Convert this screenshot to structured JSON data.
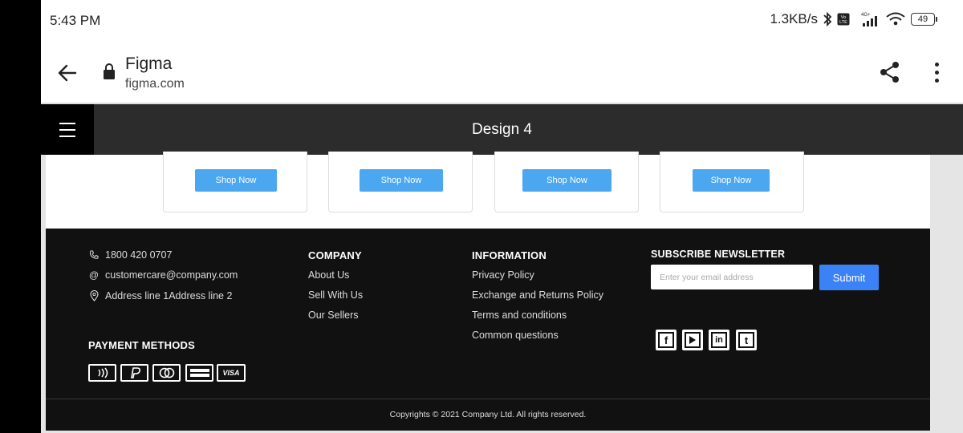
{
  "status_bar": {
    "time": "5:43 PM",
    "net_speed": "1.3KB/s",
    "network_type": "4G+",
    "battery": "49"
  },
  "browser": {
    "site_title": "Figma",
    "site_url": "figma.com"
  },
  "figma": {
    "title": "Design 4"
  },
  "cards": [
    {
      "button_label": "Shop Now"
    },
    {
      "button_label": "Shop Now"
    },
    {
      "button_label": "Shop Now"
    },
    {
      "button_label": "Shop Now"
    }
  ],
  "footer": {
    "contact": {
      "phone": "1800 420 0707",
      "email": "customercare@company.com",
      "address": "Address line 1Address line 2"
    },
    "payment_heading": "PAYMENT METHODS",
    "payment_methods": [
      "contactless-pay",
      "paypal",
      "diners-club",
      "american-express",
      "VISA"
    ],
    "company": {
      "heading": "COMPANY",
      "links": [
        "About Us",
        "Sell With Us",
        "Our Sellers"
      ]
    },
    "information": {
      "heading": "INFORMATION",
      "links": [
        "Privacy Policy",
        "Exchange and Returns Policy",
        "Terms and conditions",
        "Common questions"
      ]
    },
    "newsletter": {
      "heading": "SUBSCRIBE NEWSLETTER",
      "placeholder": "Enter your email address",
      "submit_label": "Submit"
    },
    "social": [
      "facebook-icon",
      "youtube-icon",
      "linkedin-icon",
      "twitter-icon"
    ],
    "copyright": "Copyrights © 2021 Company Ltd. All rights reserved."
  },
  "colors": {
    "shop_button": "#4ba7f0",
    "submit_button": "#3b82f6",
    "footer_bg": "#111111",
    "figma_header": "#2c2c2c"
  }
}
